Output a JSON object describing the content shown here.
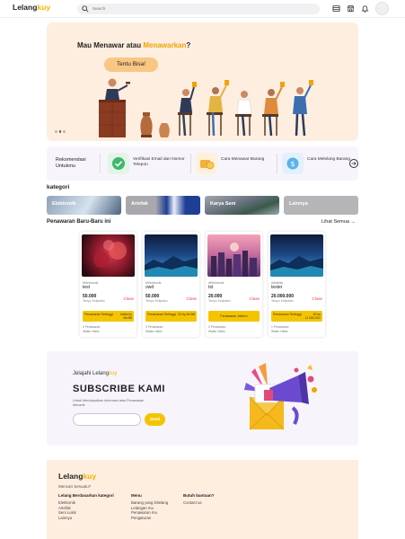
{
  "header": {
    "logo_main": "Lelang",
    "logo_accent": "kuy",
    "search_placeholder": "Search"
  },
  "hero": {
    "title_prefix": "Mau Menawar atau ",
    "title_highlight": "Menawarkan",
    "title_suffix": "?",
    "button_label": "Tentu Bisa!"
  },
  "recommendations": {
    "title": "Rekomendasi Untukmu",
    "items": [
      {
        "label": "Verifikasi Email dan Nomor Telepon",
        "icon": "check-icon",
        "color": "#e3f5e6"
      },
      {
        "label": "Cara Menawar Barang",
        "icon": "coins-icon",
        "color": "#fff1d9"
      },
      {
        "label": "Cara Melelang Barang",
        "icon": "dollar-icon",
        "color": "#e2f1fb"
      }
    ]
  },
  "categories": {
    "title": "kategori",
    "items": [
      {
        "label": "Elektronik"
      },
      {
        "label": "Artefak"
      },
      {
        "label": "Karya Seni"
      },
      {
        "label": "Lainnya"
      }
    ]
  },
  "latest": {
    "title": "Penawaran Baru-Baru ini",
    "see_all": "Lihat Semua →",
    "cards": [
      {
        "tag": "#Elektronik",
        "name": "test",
        "price": "50.000",
        "status": "Close",
        "sub": "Tempo Kelipatan",
        "bar_left": "Penawaran Tertinggi",
        "bar_right": "habis by Mr.Bill",
        "footer1": "0 Penawaran",
        "footer2": "Waktu Habis"
      },
      {
        "tag": "#Elektronik",
        "name": "owd",
        "price": "50.000",
        "status": "Close",
        "sub": "Tempo Kelipatan",
        "bar_left": "Penawaran Tertinggi",
        "bar_right": "20 by Mr.Bill",
        "footer1": "0 Penawaran",
        "footer2": "Waktu Habis"
      },
      {
        "tag": "#Elektronik",
        "name": "tst",
        "price": "20.000",
        "status": "Close",
        "sub": "Tempo Kelipatan",
        "bar_center": "Penawaran Jelbern",
        "footer1": "0 Penawaran",
        "footer2": "Waktu Habis"
      },
      {
        "tag": "#Artefak",
        "name": "tester",
        "price": "20.000.000",
        "status": "Close",
        "sub": "Tempo Kelipatan",
        "bar_left": "Penawaran Tertinggi",
        "bar_right": "30 by 11.000.001",
        "footer1": "1 Penawaran",
        "footer2": "Waktu Habis"
      }
    ]
  },
  "subscribe": {
    "small_prefix": "Jelajahi Lelang",
    "small_accent": "kuy",
    "title": "SUBSCRIBE KAMI",
    "description": "Untuk Mendapatkan Informasi atau Penawaran Menarik",
    "button": "Send"
  },
  "footer": {
    "logo_main": "Lelang",
    "logo_accent": "kuy",
    "tagline": "Mencari Sesuatu?",
    "columns": [
      {
        "heading": "Lelang Berdasarkan kategori",
        "links": [
          "Elektronik",
          "Artefak",
          "Seni Lukis",
          "Lainnya"
        ]
      },
      {
        "heading": "Menu",
        "links": [
          "Barang yang Dilelang",
          "Lelangan mu",
          "Penawaran mu",
          "Pengaturan"
        ]
      },
      {
        "heading": "Butuh bantuan?",
        "links": [
          "Contact us"
        ]
      }
    ]
  }
}
